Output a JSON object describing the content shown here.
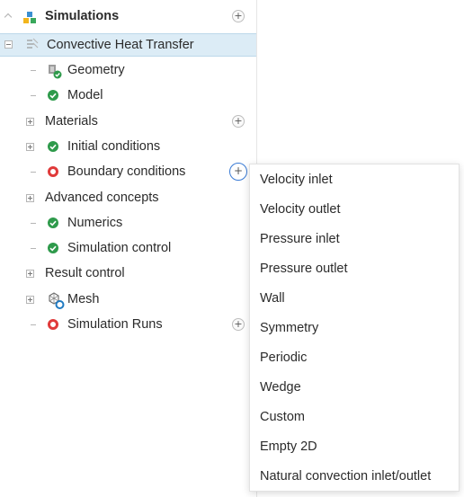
{
  "tree": {
    "root": {
      "label": "Simulations",
      "icon": "simulations-icon"
    },
    "simulation": {
      "label": "Convective Heat Transfer",
      "icon": "simulation-icon"
    },
    "items": {
      "geometry": {
        "label": "Geometry",
        "icon": "geometry-icon",
        "status": "ok"
      },
      "model": {
        "label": "Model",
        "status": "ok"
      },
      "materials": {
        "label": "Materials"
      },
      "initial_conditions": {
        "label": "Initial conditions",
        "status": "ok"
      },
      "boundary_conditions": {
        "label": "Boundary conditions",
        "status": "error"
      },
      "advanced_concepts": {
        "label": "Advanced concepts"
      },
      "numerics": {
        "label": "Numerics",
        "status": "ok"
      },
      "simulation_control": {
        "label": "Simulation control",
        "status": "ok"
      },
      "result_control": {
        "label": "Result control"
      },
      "mesh": {
        "label": "Mesh",
        "icon": "mesh-icon"
      },
      "simulation_runs": {
        "label": "Simulation Runs",
        "status": "error"
      }
    }
  },
  "add_menu": {
    "items": [
      "Velocity inlet",
      "Velocity outlet",
      "Pressure inlet",
      "Pressure outlet",
      "Wall",
      "Symmetry",
      "Periodic",
      "Wedge",
      "Custom",
      "Empty 2D",
      "Natural convection inlet/outlet"
    ]
  },
  "colors": {
    "ok": "#2e9a4b",
    "error": "#e03a3a",
    "selected_bg": "#dcecf6",
    "active_button": "#3a7bd5"
  }
}
